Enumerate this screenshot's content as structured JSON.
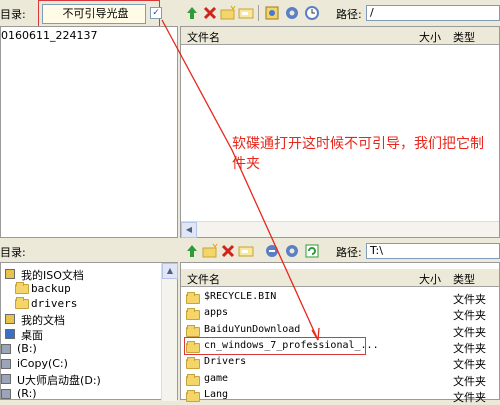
{
  "top_left": {
    "label": "目录:",
    "dropdown_value": "不可引导光盘",
    "tree_item": "0160611_224137"
  },
  "top_right": {
    "path_label": "路径:",
    "path_value": "/",
    "columns": {
      "name": "文件名",
      "size": "大小",
      "type": "类型"
    }
  },
  "bottom_left": {
    "label": "目录:",
    "tree": [
      {
        "label": "我的ISO文档",
        "icon": "iso-icon"
      },
      {
        "label": "backup",
        "icon": "folder-icon"
      },
      {
        "label": "drivers",
        "icon": "folder-icon"
      },
      {
        "label": "我的文档",
        "icon": "documents-icon"
      },
      {
        "label": "桌面",
        "icon": "desktop-icon"
      },
      {
        "label": "(B:)",
        "icon": "drive-icon"
      },
      {
        "label": "iCopy(C:)",
        "icon": "drive-icon"
      },
      {
        "label": "U大师启动盘(D:)",
        "icon": "drive-icon"
      },
      {
        "label": "(R:)",
        "icon": "drive-icon"
      }
    ]
  },
  "bottom_right": {
    "path_label": "路径:",
    "path_value": "T:\\",
    "columns": {
      "name": "文件名",
      "size": "大小",
      "type": "类型"
    },
    "rows": [
      {
        "name": "$RECYCLE.BIN",
        "type": "文件夹"
      },
      {
        "name": "apps",
        "type": "文件夹"
      },
      {
        "name": "BaiduYunDownload",
        "type": "文件夹"
      },
      {
        "name": "cn_windows_7_professional_...",
        "type": "文件夹"
      },
      {
        "name": "Drivers",
        "type": "文件夹"
      },
      {
        "name": "game",
        "type": "文件夹"
      },
      {
        "name": "Lang",
        "type": "文件夹"
      }
    ]
  },
  "annotation": {
    "line1": "软碟通打开这时候不可引导，我们把它制",
    "line2": "件夹"
  },
  "colors": {
    "annotation_red": "#e8261c",
    "highlight_red": "#d9383a"
  }
}
